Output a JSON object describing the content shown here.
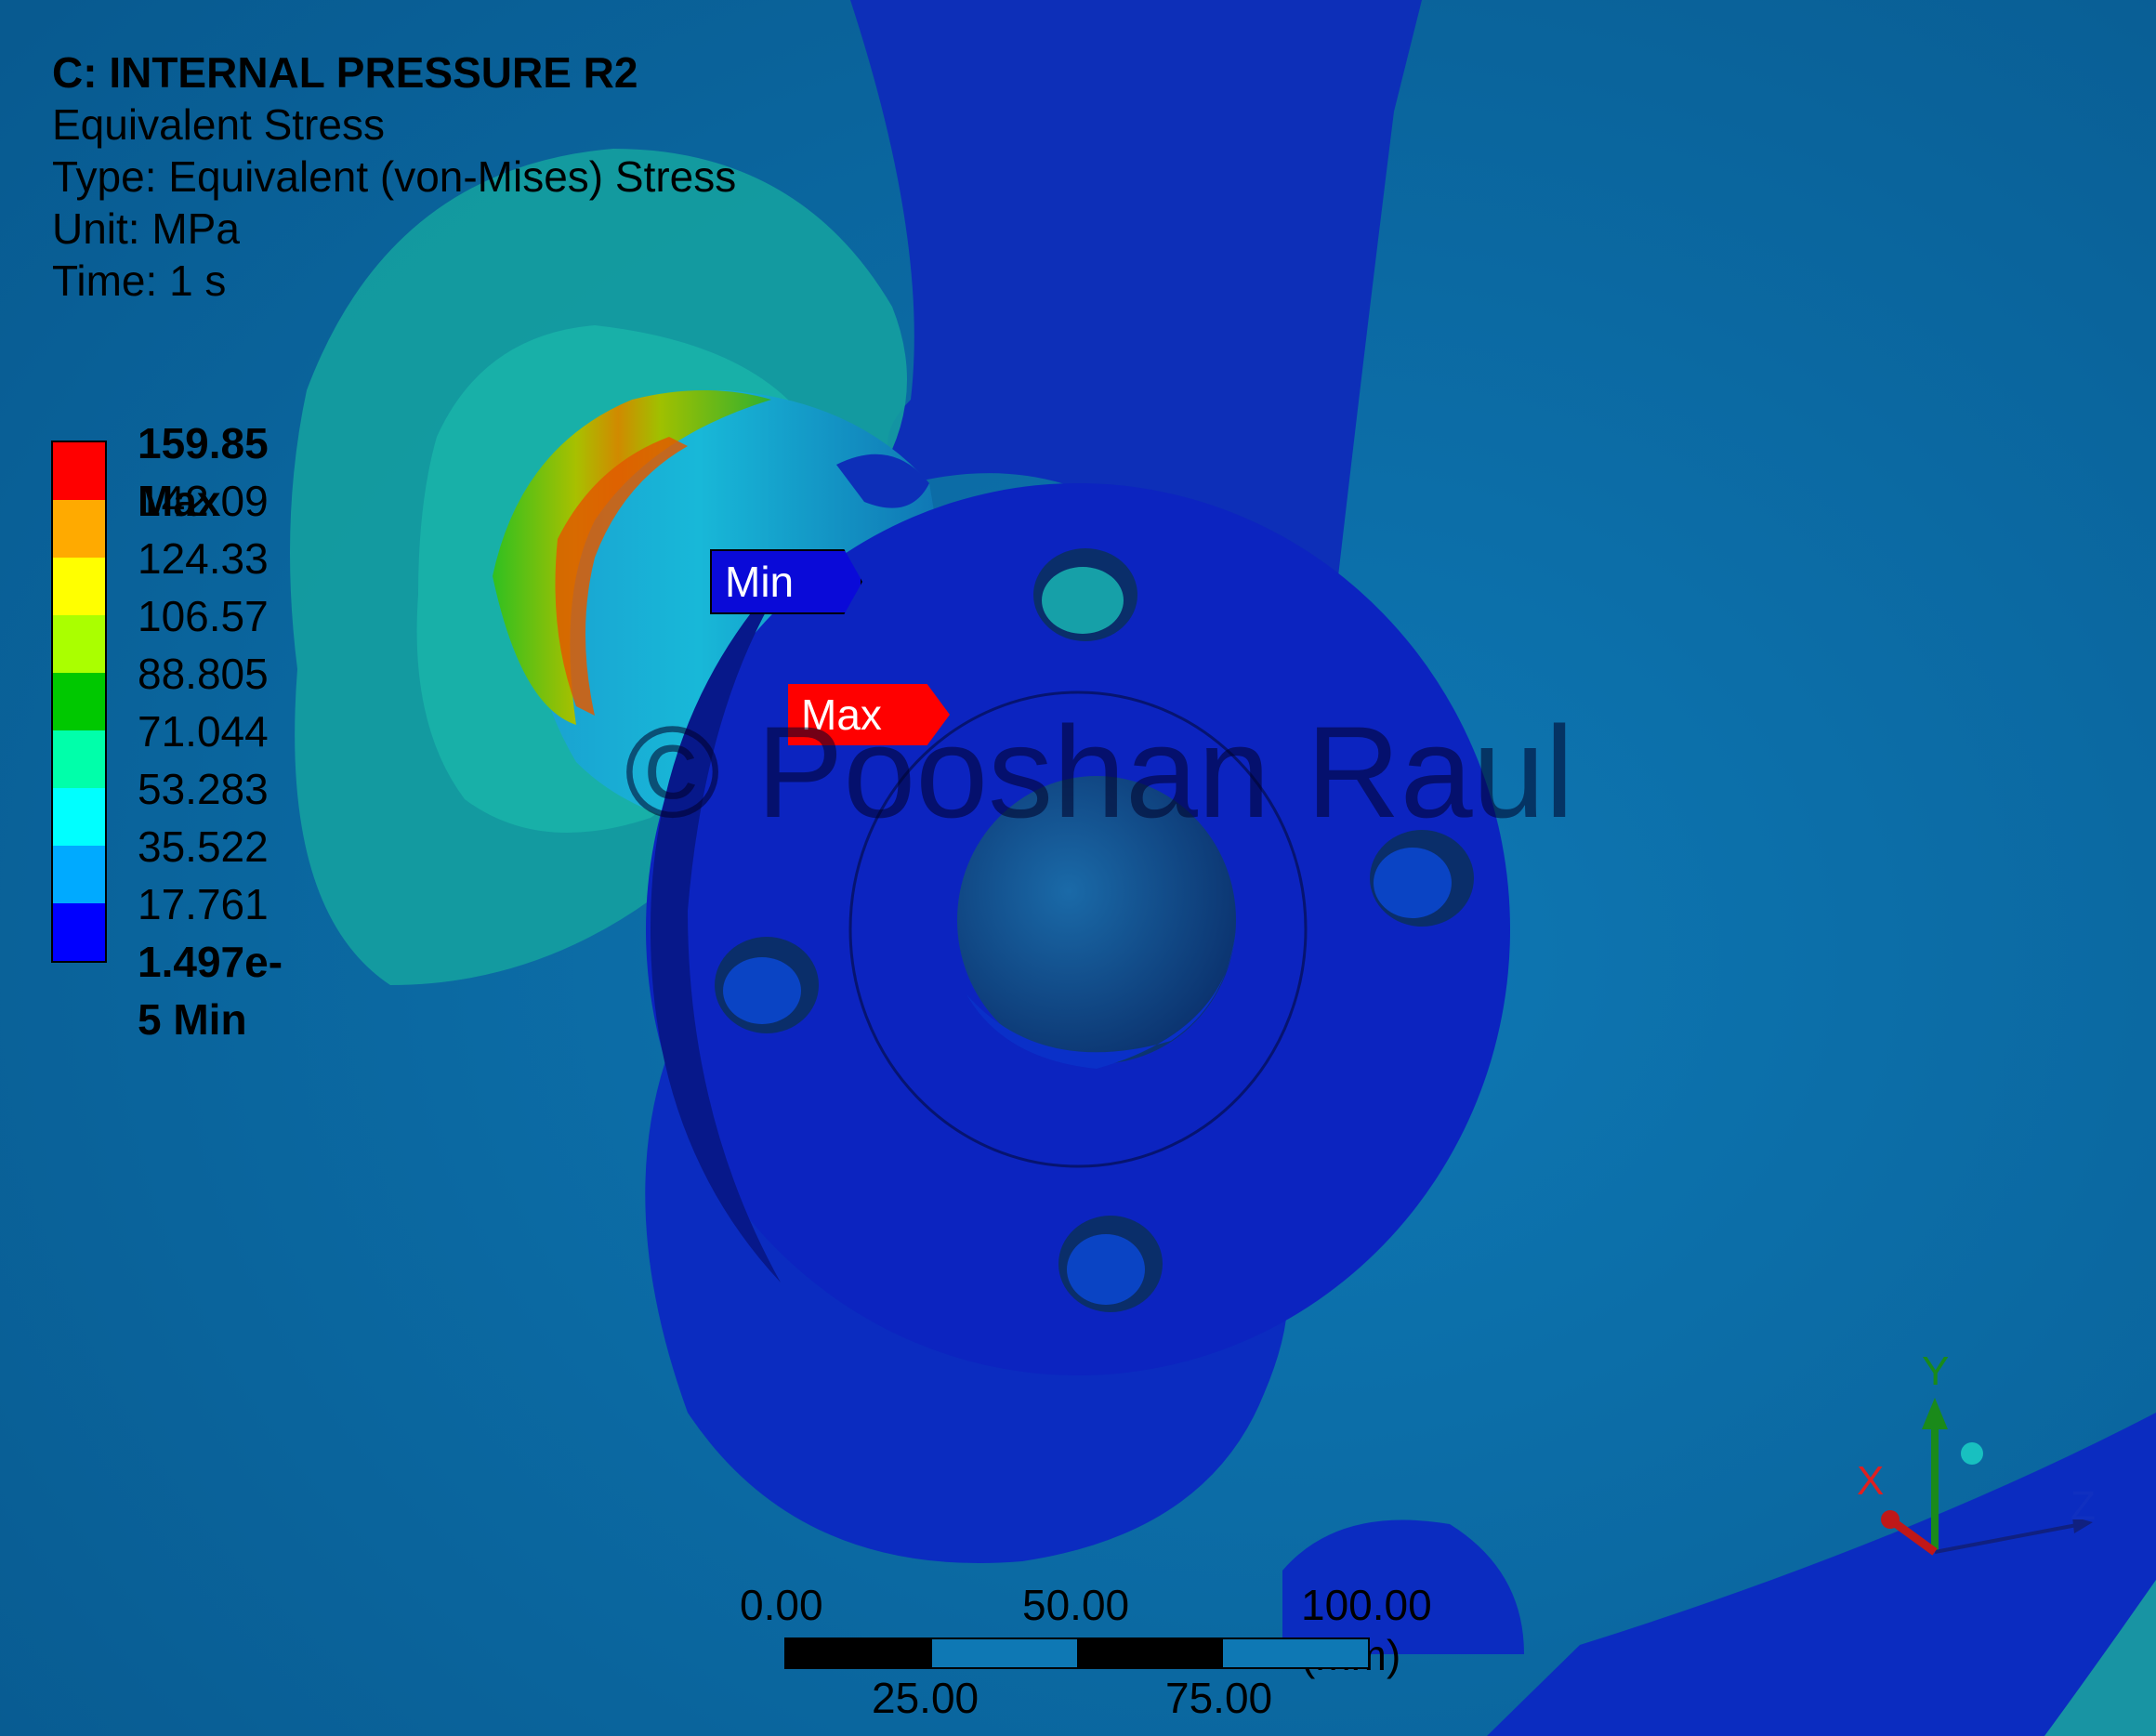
{
  "header": {
    "title": "C: INTERNAL PRESSURE R2",
    "result": "Equivalent Stress",
    "type": "Type: Equivalent (von-Mises) Stress",
    "unit": "Unit: MPa",
    "time": "Time: 1 s"
  },
  "legend": {
    "max_label": "159.85 Max",
    "labels": [
      "142.09",
      "124.33",
      "106.57",
      "88.805",
      "71.044",
      "53.283",
      "35.522",
      "17.761"
    ],
    "min_label": "1.497e-5 Min",
    "colors": [
      "#ff0000",
      "#ffaa00",
      "#ffff00",
      "#aaff00",
      "#00c800",
      "#00ffaa",
      "#00ffff",
      "#00aaff",
      "#0000ff"
    ]
  },
  "probes": {
    "min": "Min",
    "max": "Max"
  },
  "watermark": "© Pooshan Raul",
  "scale": {
    "top_ticks": [
      "0.00",
      "50.00",
      "100.00 (mm)"
    ],
    "bottom_ticks": [
      "25.00",
      "75.00"
    ]
  },
  "triad": {
    "x": "X",
    "y": "Y",
    "z": "Z"
  }
}
